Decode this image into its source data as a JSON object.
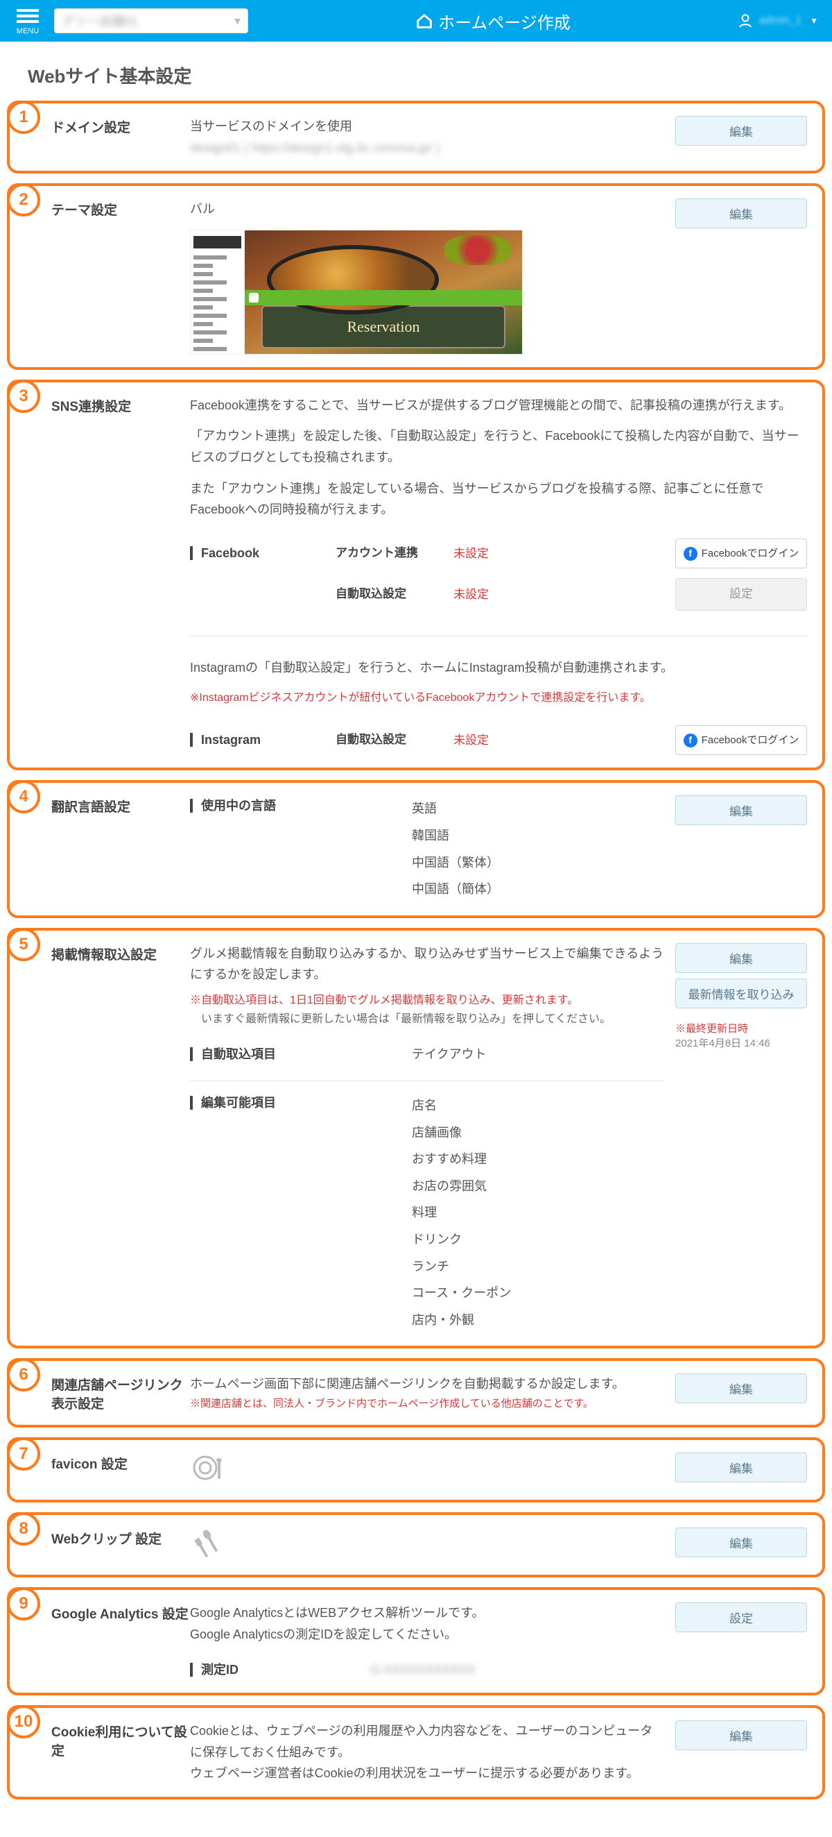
{
  "header": {
    "menu_label": "MENU",
    "app_title": "ホームページ作成",
    "user_placeholder": "admin_1"
  },
  "page_title": "Webサイト基本設定",
  "btn": {
    "edit": "編集",
    "settings": "設定",
    "fetch_latest": "最新情報を取り込み",
    "fb_login": "Facebookでログイン"
  },
  "sections": [
    {
      "num": "1",
      "label": "ドメイン設定",
      "body": {
        "line1": "当サービスのドメインを使用",
        "line2_blur": "design01 ( https://design1.stg.dc.conviva.jp/ )"
      },
      "action": "edit"
    },
    {
      "num": "2",
      "label": "テーマ設定",
      "body": {
        "theme_name": "バル",
        "thumb_banner": "Reservation"
      },
      "action": "edit"
    },
    {
      "num": "3",
      "label": "SNS連携設定",
      "body": {
        "para1": "Facebook連携をすることで、当サービスが提供するブログ管理機能との間で、記事投稿の連携が行えます。",
        "para2": "「アカウント連携」を設定した後、「自動取込設定」を行うと、Facebookにて投稿した内容が自動で、当サービスのブログとしても投稿されます。",
        "para3": "また「アカウント連携」を設定している場合、当サービスからブログを投稿する際、記事ごとに任意でFacebookへの同時投稿が行えます。",
        "fb_head": "Facebook",
        "fb_row1_label": "アカウント連携",
        "fb_row1_val": "未設定",
        "fb_row2_label": "自動取込設定",
        "fb_row2_val": "未設定",
        "ig_para1": "Instagramの「自動取込設定」を行うと、ホームにInstagram投稿が自動連携されます。",
        "ig_note": "※Instagramビジネスアカウントが紐付いているFacebookアカウントで連携設定を行います。",
        "ig_head": "Instagram",
        "ig_row_label": "自動取込設定",
        "ig_row_val": "未設定"
      }
    },
    {
      "num": "4",
      "label": "翻訳言語設定",
      "body": {
        "sub": "使用中の言語",
        "langs": [
          "英語",
          "韓国語",
          "中国語（繁体）",
          "中国語（簡体）"
        ]
      },
      "action": "edit"
    },
    {
      "num": "5",
      "label": "掲載情報取込設定",
      "body": {
        "para": "グルメ掲載情報を自動取り込みするか、取り込みせず当サービス上で編集できるようにするかを設定します。",
        "note1": "※自動取込項目は、1日1回自動でグルメ掲載情報を取り込み、更新されます。",
        "note2": "　いますぐ最新情報に更新したい場合は「最新情報を取り込み」を押してください。",
        "sub1": "自動取込項目",
        "sub1_val": "テイクアウト",
        "sub2": "編集可能項目",
        "sub2_vals": [
          "店名",
          "店舗画像",
          "おすすめ料理",
          "お店の雰囲気",
          "料理",
          "ドリンク",
          "ランチ",
          "コース・クーポン",
          "店内・外観"
        ],
        "lastupd_label": "※最終更新日時",
        "lastupd_val": "2021年4月8日 14:46"
      }
    },
    {
      "num": "6",
      "label": "関連店舗ページリンク表示設定",
      "body": {
        "para": "ホームページ画面下部に関連店舗ページリンクを自動掲載するか設定します。",
        "note": "※関連店舗とは、同法人・ブランド内でホームページ作成している他店舗のことです。"
      },
      "action": "edit"
    },
    {
      "num": "7",
      "label": "favicon 設定",
      "action": "edit"
    },
    {
      "num": "8",
      "label": "Webクリップ 設定",
      "action": "edit"
    },
    {
      "num": "9",
      "label": "Google Analytics 設定",
      "body": {
        "para1": "Google AnalyticsとはWEBアクセス解析ツールです。",
        "para2": "Google Analyticsの測定IDを設定してください。",
        "sub": "測定ID",
        "val_blur": "G-XXXXXXXXXXX"
      },
      "action": "settings"
    },
    {
      "num": "10",
      "label": "Cookie利用について設定",
      "body": {
        "para1": "Cookieとは、ウェブページの利用履歴や入力内容などを、ユーザーのコンピュータに保存しておく仕組みです。",
        "para2": "ウェブページ運営者はCookieの利用状況をユーザーに提示する必要があります。"
      },
      "action": "edit"
    }
  ]
}
